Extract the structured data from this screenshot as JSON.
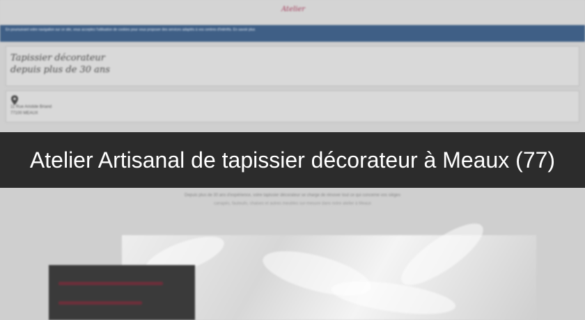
{
  "header": {
    "logo": "Atelier"
  },
  "cookie_notice": "En poursuivant votre navigation sur ce site, vous acceptez l'utilisation de cookies pour vous proposer des services adaptés à vos centres d'intérêts. En savoir plus",
  "slogan": {
    "line1": "Tapissier décorateur",
    "line2": "depuis plus de 30 ans"
  },
  "address": {
    "street": "11 Rue Aristide Briand",
    "city": "77100 MEAUX"
  },
  "intro": {
    "line1": "Depuis plus de 30 ans d'expérience, votre tapissier décorateur se charge de rénover tout ce qui concerne vos sièges",
    "line2": "canapés, fauteuils, chaises et autres meubles sur-mesure dans notre atelier à Meaux"
  },
  "banner": {
    "title": "Atelier Artisanal de tapissier décorateur à Meaux (77)"
  },
  "colors": {
    "cookie_bar": "#3f5f86",
    "banner_bg": "#121212",
    "accent": "#a33b5a"
  },
  "icons": {
    "location": "map-pin-icon"
  }
}
